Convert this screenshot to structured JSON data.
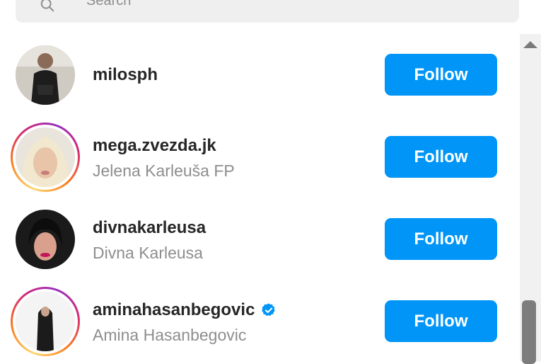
{
  "search": {
    "placeholder": "Search"
  },
  "suggestions": [
    {
      "username": "milosph",
      "full_name": "",
      "verified": false,
      "story_ring": false,
      "button": "Follow"
    },
    {
      "username": "mega.zvezda.jk",
      "full_name": "Jelena Karleuša FP",
      "verified": false,
      "story_ring": true,
      "button": "Follow"
    },
    {
      "username": "divnakarleusa",
      "full_name": "Divna Karleusa",
      "verified": false,
      "story_ring": false,
      "button": "Follow"
    },
    {
      "username": "aminahasanbegovic",
      "full_name": "Amina Hasanbegovic",
      "verified": true,
      "story_ring": true,
      "button": "Follow"
    }
  ],
  "colors": {
    "follow_button": "#0095f6",
    "verified_badge": "#0095f6",
    "secondary_text": "#8e8e8e"
  },
  "icons": {
    "search": "search-icon",
    "verified": "verified-badge-icon",
    "scroll_up": "scroll-up-arrow-icon"
  }
}
